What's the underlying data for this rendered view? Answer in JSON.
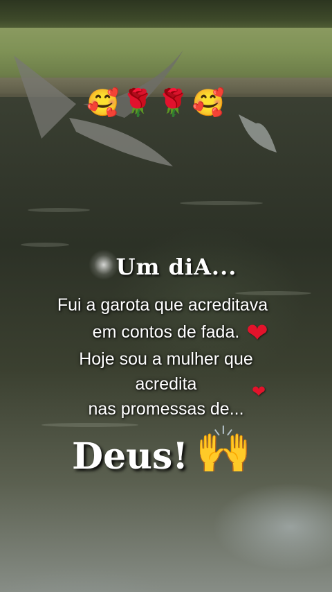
{
  "emoji_row": [
    "🥰",
    "🌹",
    "🌹",
    "🥰"
  ],
  "heading": "Um diA...",
  "message": {
    "line1": "Fui a garota que acreditava",
    "line2": "em contos de fada.",
    "line3": "Hoje sou a mulher que",
    "line4": "acredita",
    "line5": "nas promessas de..."
  },
  "heart": "❤",
  "closing_word": "Deus!",
  "closing_emoji": "🙌"
}
